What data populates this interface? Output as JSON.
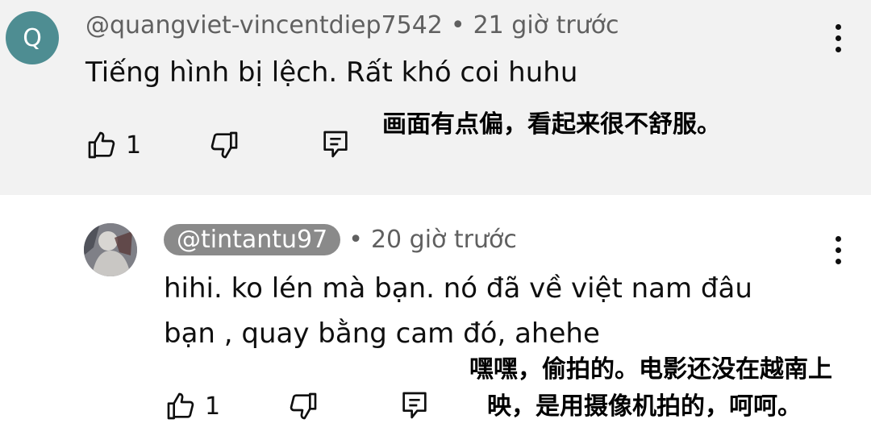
{
  "comments": [
    {
      "avatar_letter": "Q",
      "author": "@quangviet-vincentdiep7542",
      "separator": "•",
      "time": "21 giờ trước",
      "text": "Tiếng hình bị lệch. Rất khó coi huhu",
      "like_count": "1",
      "translation": "画面有点偏，看起来很不舒服。"
    },
    {
      "author": "@tintantu97",
      "separator": "•",
      "time": "20 giờ trước",
      "text_line1": "hihi. ko lén mà bạn. nó đã về việt nam đâu",
      "text_line2": "bạn , quay bằng cam đó, ahehe",
      "like_count": "1",
      "translation_line1": "嘿嘿，偷拍的。电影还没在越南上",
      "translation_line2": "映，是用摄像机拍的，呵呵。"
    }
  ],
  "icons": {
    "like": "thumbs-up-icon",
    "dislike": "thumbs-down-icon",
    "reply": "reply-comment-icon",
    "more": "more-vertical-icon"
  },
  "colors": {
    "top_comment_bg": "#f2f2f2",
    "avatar_q_bg": "#4e8d92",
    "handle_pill_bg": "#8a8a8a",
    "meta_text": "#606060"
  }
}
